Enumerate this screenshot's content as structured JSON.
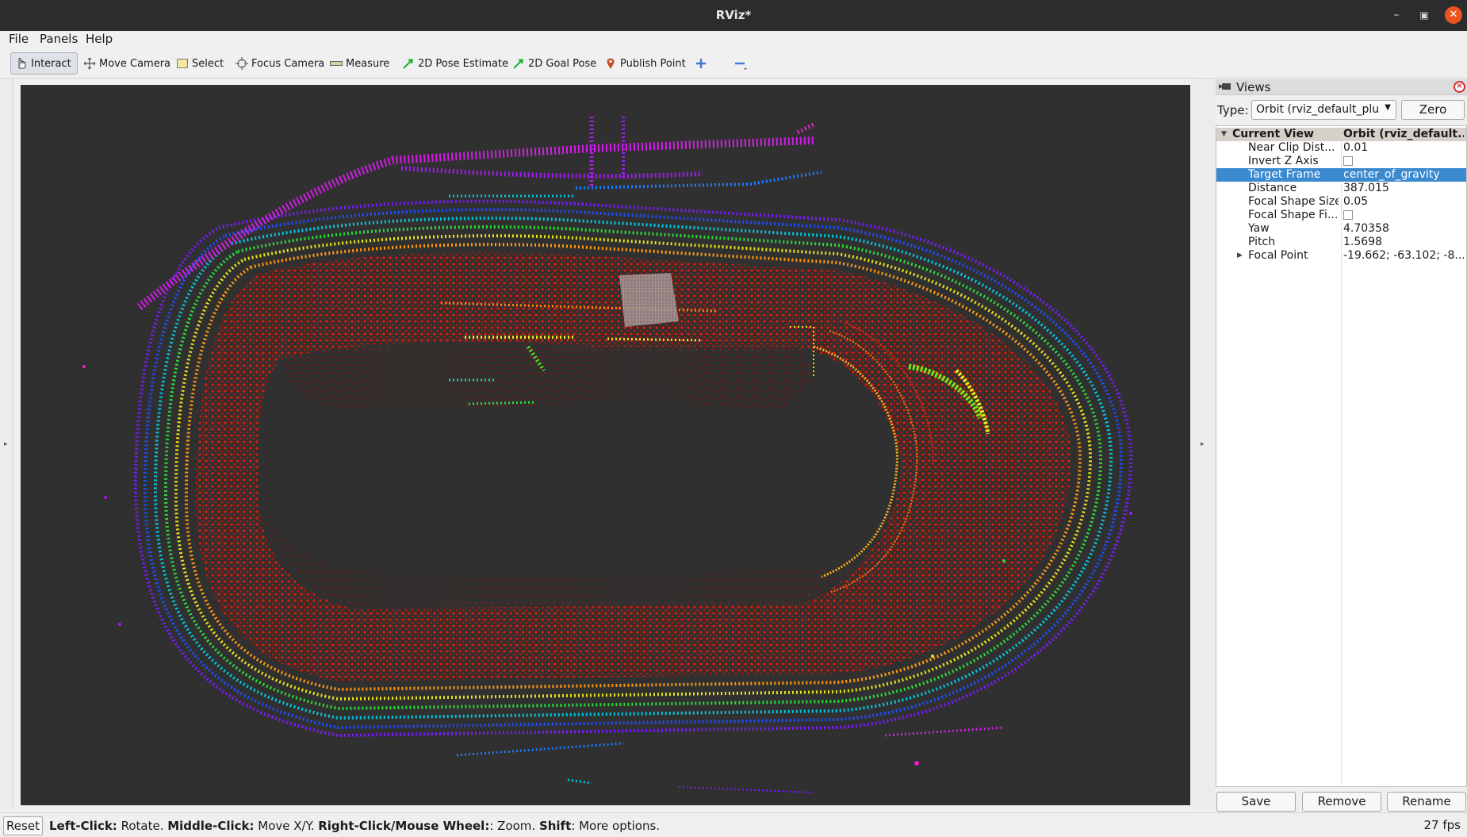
{
  "window": {
    "title": "RViz*"
  },
  "menu": {
    "file": "File",
    "panels": "Panels",
    "help": "Help"
  },
  "toolbar": {
    "interact": "Interact",
    "move_camera": "Move Camera",
    "select": "Select",
    "focus_camera": "Focus Camera",
    "measure": "Measure",
    "pose_estimate": "2D Pose Estimate",
    "goal_pose": "2D Goal Pose",
    "publish_point": "Publish Point",
    "add_tool_icon": "plus-icon",
    "remove_tool_icon": "minus-icon"
  },
  "viewport": {
    "background": "#303030",
    "content": "lidar-point-cloud-oval-track"
  },
  "views_panel": {
    "title": "Views",
    "type_label": "Type:",
    "type_value": "Orbit (rviz_default_plu",
    "zero_label": "Zero",
    "header": {
      "name": "Current View",
      "value": "Orbit (rviz_default..."
    },
    "properties": [
      {
        "name": "Near Clip Dist...",
        "value": "0.01"
      },
      {
        "name": "Invert Z Axis",
        "value": ""
      },
      {
        "name": "Target Frame",
        "value": "center_of_gravity"
      },
      {
        "name": "Distance",
        "value": "387.015"
      },
      {
        "name": "Focal Shape Size",
        "value": "0.05"
      },
      {
        "name": "Focal Shape Fi...",
        "value": ""
      },
      {
        "name": "Yaw",
        "value": "4.70358"
      },
      {
        "name": "Pitch",
        "value": "1.5698"
      },
      {
        "name": "Focal Point",
        "value": "-19.662; -63.102; -8...."
      }
    ],
    "invert_z_checked": false,
    "focal_shape_fixed_checked": false,
    "selected_property": "Target Frame",
    "selection_color": "#3b89cf",
    "save_label": "Save",
    "remove_label": "Remove",
    "rename_label": "Rename"
  },
  "statusbar": {
    "reset_label": "Reset",
    "hint_left_b": "Left-Click:",
    "hint_left": " Rotate. ",
    "hint_mid_b": "Middle-Click:",
    "hint_mid": " Move X/Y. ",
    "hint_right_b": "Right-Click/Mouse Wheel:",
    "hint_right": ": Zoom. ",
    "hint_shift_b": "Shift",
    "hint_shift": ": More options.",
    "fps": "27 fps"
  }
}
